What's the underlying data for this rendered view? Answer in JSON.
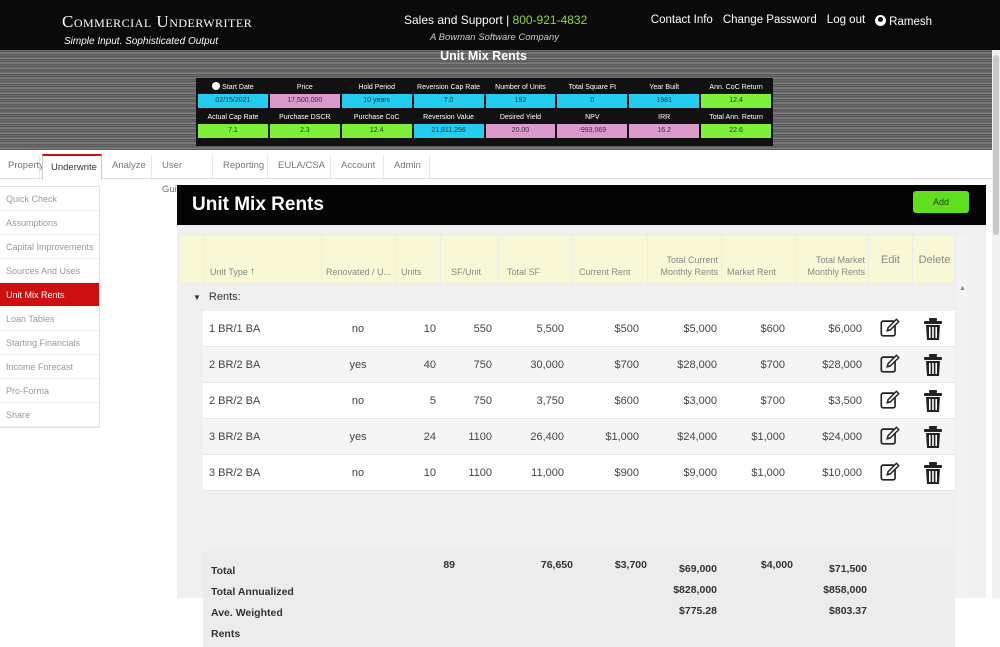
{
  "header": {
    "brand": "Commercial Underwriter",
    "tagline": "Simple Input. Sophisticated Output",
    "support_label": "Sales and Support |",
    "phone": "800-921-4832",
    "company": "A Bowman Software Company",
    "links": [
      "Contact Info",
      "Change Password",
      "Log out"
    ],
    "user": "Ramesh"
  },
  "band_title": "Unit Mix Rents",
  "metrics": {
    "row1": [
      {
        "label": "Start Date",
        "value": "02/15/2021",
        "color": "#22cdf0"
      },
      {
        "label": "Price",
        "value": "17,500,000",
        "color": "#db99cc"
      },
      {
        "label": "Hold Period",
        "value": "10 years",
        "color": "#22cdf0"
      },
      {
        "label": "Reversion Cap Rate",
        "value": "7.0",
        "color": "#22cdf0"
      },
      {
        "label": "Number of Units",
        "value": "192",
        "color": "#22cdf0"
      },
      {
        "label": "Total Square Ft",
        "value": "0",
        "color": "#22cdf0"
      },
      {
        "label": "Year Built",
        "value": "1981",
        "color": "#22cdf0"
      },
      {
        "label": "Ann. CoC Return",
        "value": "12.4",
        "color": "#7ff03a"
      }
    ],
    "row2": [
      {
        "label": "Actual Cap Rate",
        "value": "7.1",
        "color": "#7ff03a"
      },
      {
        "label": "Purchase DSCR",
        "value": "2.3",
        "color": "#7ff03a"
      },
      {
        "label": "Purchase CoC",
        "value": "12.4",
        "color": "#7ff03a"
      },
      {
        "label": "Reversion Value",
        "value": "21,811,256",
        "color": "#22cdf0"
      },
      {
        "label": "Desired Yield",
        "value": "20.00",
        "color": "#db99cc"
      },
      {
        "label": "NPV",
        "value": "-993,069",
        "color": "#db99cc"
      },
      {
        "label": "IRR",
        "value": "16.2",
        "color": "#db99cc"
      },
      {
        "label": "Total Ann. Return",
        "value": "22.6",
        "color": "#7ff03a"
      }
    ]
  },
  "tabs": [
    "Property",
    "Underwrite",
    "Analyze",
    "User Guide",
    "Reporting",
    "EULA/CSA",
    "Account",
    "Admin"
  ],
  "active_tab": "Underwrite",
  "side_menu": [
    "Quick Check",
    "Assumptions",
    "Capital Improvements",
    "Sources And Uses",
    "Unit Mix Rents",
    "Loan Tables",
    "Starting Financials",
    "Income Forecast",
    "Pro-Forma",
    "Share"
  ],
  "active_side": "Unit Mix Rents",
  "panel": {
    "title": "Unit Mix Rents",
    "add_label": "Add"
  },
  "table": {
    "headers": {
      "unit_type": "Unit Type",
      "renovated": "Renovated / U...",
      "units": "Units",
      "sf_unit": "SF/Unit",
      "total_sf": "Total SF",
      "current_rent": "Current Rent",
      "total_current": "Total Current Monthly Rents",
      "market_rent": "Market Rent",
      "total_market": "Total Market Monthly Rents",
      "edit": "Edit",
      "delete": "Delete"
    },
    "group_label": "Rents:",
    "rows": [
      {
        "unit_type": "1 BR/1 BA",
        "renovated": "no",
        "units": "10",
        "sf_unit": "550",
        "total_sf": "5,500",
        "current_rent": "$500",
        "total_current": "$5,000",
        "market_rent": "$600",
        "total_market": "$6,000"
      },
      {
        "unit_type": "2 BR/2 BA",
        "renovated": "yes",
        "units": "40",
        "sf_unit": "750",
        "total_sf": "30,000",
        "current_rent": "$700",
        "total_current": "$28,000",
        "market_rent": "$700",
        "total_market": "$28,000"
      },
      {
        "unit_type": "2 BR/2 BA",
        "renovated": "no",
        "units": "5",
        "sf_unit": "750",
        "total_sf": "3,750",
        "current_rent": "$600",
        "total_current": "$3,000",
        "market_rent": "$700",
        "total_market": "$3,500"
      },
      {
        "unit_type": "3 BR/2 BA",
        "renovated": "yes",
        "units": "24",
        "sf_unit": "1100",
        "total_sf": "26,400",
        "current_rent": "$1,000",
        "total_current": "$24,000",
        "market_rent": "$1,000",
        "total_market": "$24,000"
      },
      {
        "unit_type": "3 BR/2 BA",
        "renovated": "no",
        "units": "10",
        "sf_unit": "1100",
        "total_sf": "11,000",
        "current_rent": "$900",
        "total_current": "$9,000",
        "market_rent": "$1,000",
        "total_market": "$10,000"
      }
    ],
    "totals": {
      "labels": [
        "Total",
        "Total Annualized",
        "Ave. Weighted",
        "Rents"
      ],
      "units": "89",
      "total_sf": "76,650",
      "current_rent": "$3,700",
      "total_current": [
        "$69,000",
        "$828,000",
        "$775.28"
      ],
      "market_rent": "$4,000",
      "total_market": [
        "$71,500",
        "$858,000",
        "$803.37"
      ]
    }
  }
}
